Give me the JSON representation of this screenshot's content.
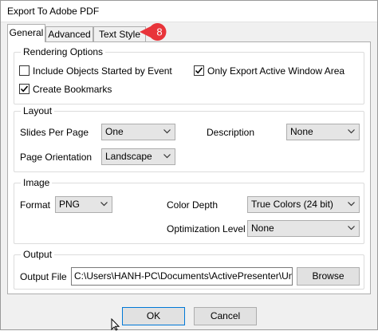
{
  "window": {
    "title": "Export To Adobe PDF"
  },
  "tabs": [
    {
      "label": "General",
      "active": true
    },
    {
      "label": "Advanced",
      "active": false
    },
    {
      "label": "Text Style",
      "active": false
    }
  ],
  "callout": {
    "number": "8",
    "color": "#e8343a"
  },
  "rendering": {
    "legend": "Rendering Options",
    "include_objects": {
      "label": "Include Objects Started by Event",
      "checked": false
    },
    "only_export": {
      "label": "Only Export Active Window Area",
      "checked": true
    },
    "create_bookmarks": {
      "label": "Create Bookmarks",
      "checked": true
    }
  },
  "layout": {
    "legend": "Layout",
    "slides_per_page_label": "Slides Per Page",
    "slides_per_page_value": "One",
    "description_label": "Description",
    "description_value": "None",
    "orientation_label": "Page Orientation",
    "orientation_value": "Landscape"
  },
  "image": {
    "legend": "Image",
    "format_label": "Format",
    "format_value": "PNG",
    "color_depth_label": "Color Depth",
    "color_depth_value": "True Colors (24 bit)",
    "optimization_label": "Optimization Level",
    "optimization_value": "None"
  },
  "output": {
    "legend": "Output",
    "file_label": "Output File",
    "file_value": "C:\\Users\\HANH-PC\\Documents\\ActivePresenter\\Untit",
    "browse_label": "Browse"
  },
  "buttons": {
    "ok": "OK",
    "cancel": "Cancel"
  },
  "colors": {
    "accent": "#0078d7",
    "check": "#000000"
  }
}
